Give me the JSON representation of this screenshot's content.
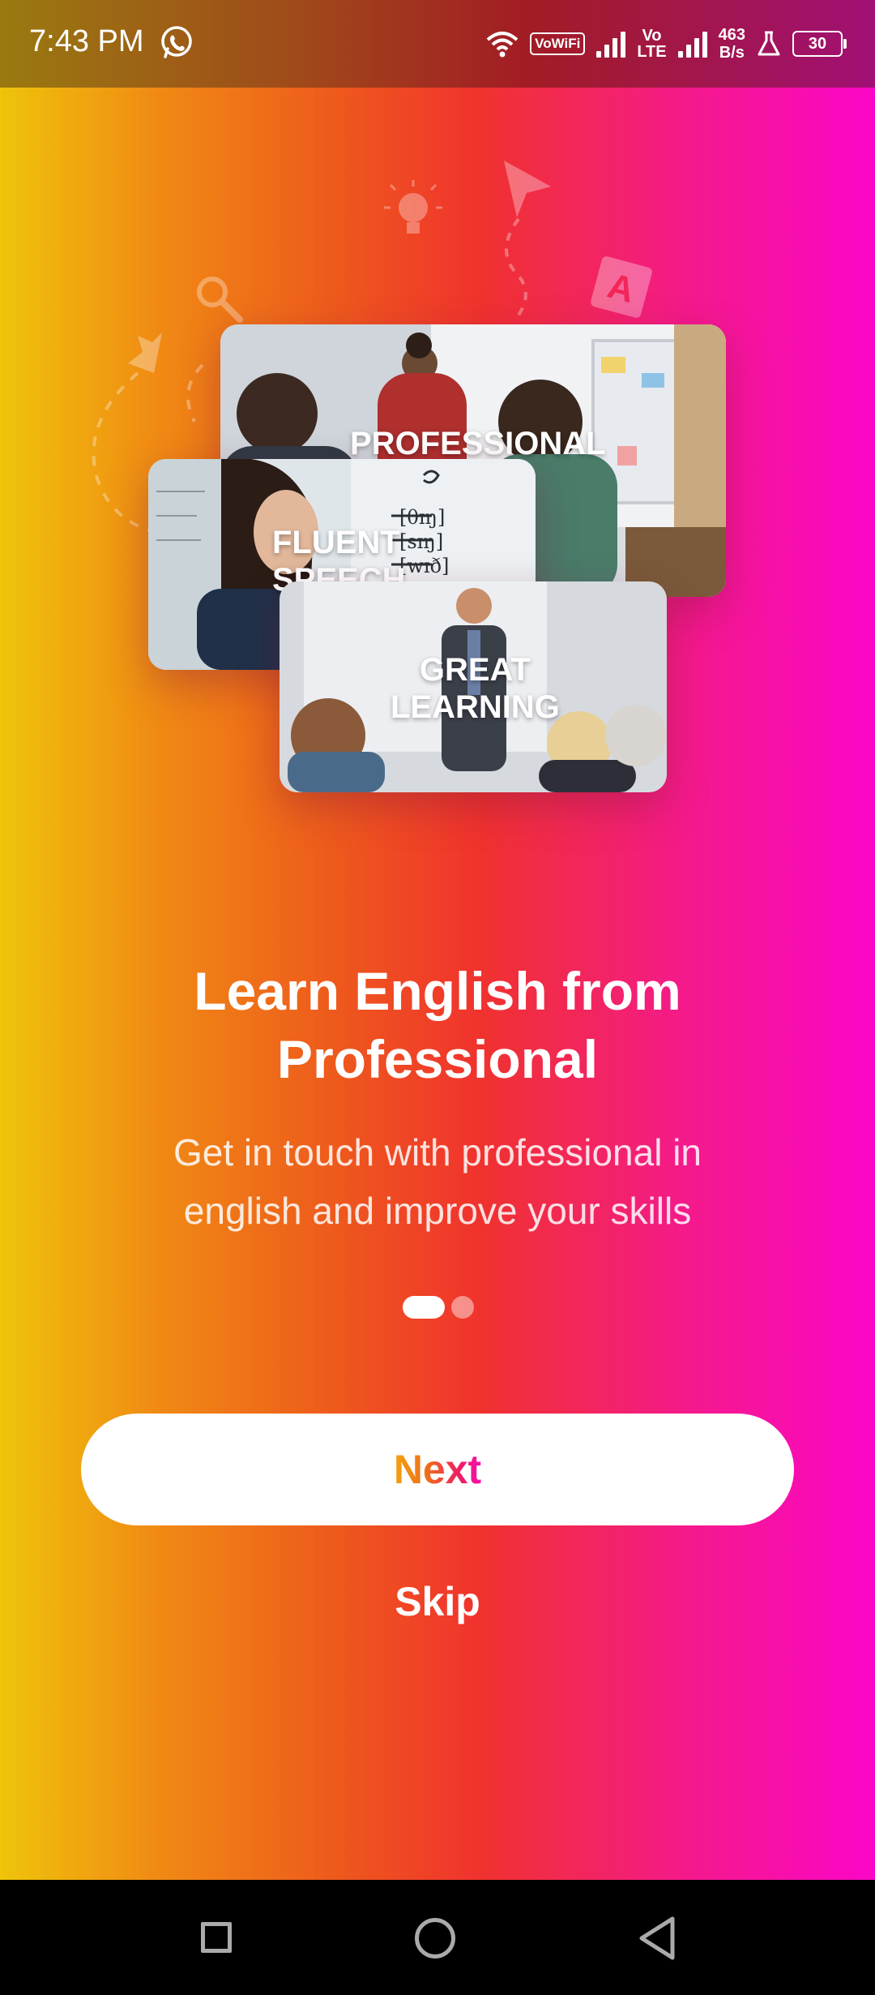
{
  "status_bar": {
    "time": "7:43 PM",
    "vowifi": "VoWiFi",
    "volte_top": "Vo",
    "volte_bottom": "LTE",
    "speed_value": "463",
    "speed_unit": "B/s",
    "battery": "30",
    "icons": [
      "whatsapp-icon",
      "wifi-icon",
      "signal-icon",
      "lab-flask-icon",
      "battery-icon"
    ]
  },
  "illustration": {
    "cards": [
      {
        "label": "PROFESSIONAL"
      },
      {
        "label_line1": "FLUENT",
        "label_line2": "SPEECH"
      },
      {
        "label_line1": "GREAT",
        "label_line2": "LEARNING"
      }
    ],
    "decor_icons": [
      "lightbulb-icon",
      "cursor-arrow-icon",
      "letter-a-icon",
      "magnifier-icon",
      "paper-plane-icon"
    ]
  },
  "onboarding": {
    "title_line1": "Learn English from",
    "title_line2": "Professional",
    "subtitle_line1": "Get in touch with professional in",
    "subtitle_line2": "english and improve your skills",
    "page_count": 2,
    "current_page": 1
  },
  "actions": {
    "next_label": "Next",
    "skip_label": "Skip"
  },
  "nav_bar": {
    "icons": [
      "recent-apps-icon",
      "home-icon",
      "back-icon"
    ]
  },
  "colors": {
    "gradient_left": "#efc40a",
    "gradient_mid": "#f0322e",
    "gradient_right": "#fb06c8"
  }
}
